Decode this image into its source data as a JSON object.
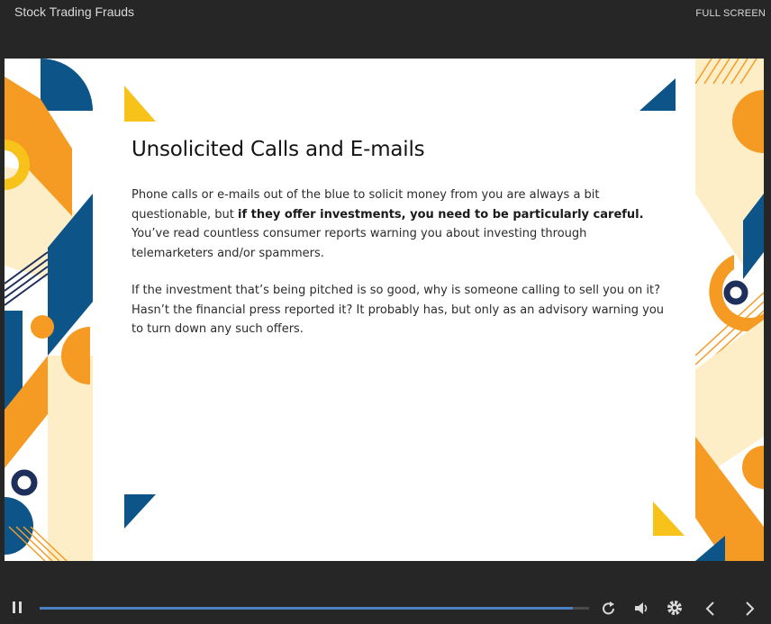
{
  "window": {
    "title": "Stock Trading Frauds",
    "fullscreen_label": "FULL SCREEN"
  },
  "slide": {
    "heading": "Unsolicited Calls and E-mails",
    "paragraph1": {
      "part1": "Phone calls or e-mails out of the blue to solicit money from you are always a bit questionable, but ",
      "bold": "if they offer investments, you need to be particularly careful.",
      "part2": " You’ve read countless consumer reports warning you about investing through telemarketers and/or spammers."
    },
    "paragraph2": "If the investment that’s being pitched is so good, why is someone calling to sell you on it? Hasn’t the financial press reported it? It probably has, but only as an advisory warning you to turn down any such offers."
  },
  "player": {
    "progress_fraction": 0.97,
    "icons": [
      "pause-icon",
      "replay-icon",
      "volume-icon",
      "settings-icon",
      "prev-arrow-icon",
      "next-arrow-icon"
    ]
  },
  "colors": {
    "navy": "#0d5489",
    "orange": "#f59b23",
    "yellow": "#f7c21a",
    "cream": "#fdeec8",
    "dark_navy": "#1f2f5c",
    "progress": "#4a7fc1"
  }
}
